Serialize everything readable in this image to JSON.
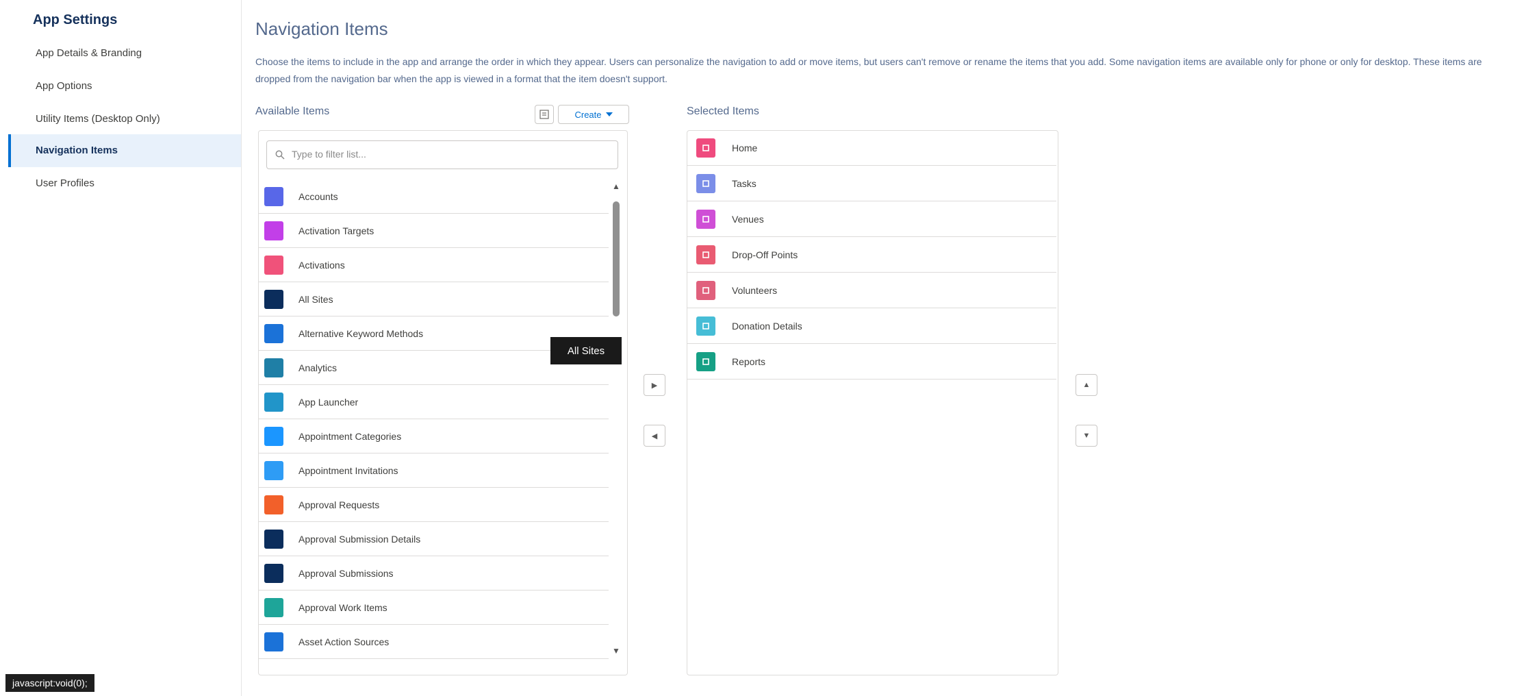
{
  "sidebar": {
    "title": "App Settings",
    "items": [
      {
        "label": "App Details & Branding",
        "active": false
      },
      {
        "label": "App Options",
        "active": false
      },
      {
        "label": "Utility Items (Desktop Only)",
        "active": false
      },
      {
        "label": "Navigation Items",
        "active": true
      },
      {
        "label": "User Profiles",
        "active": false
      }
    ]
  },
  "main": {
    "title": "Navigation Items",
    "description": "Choose the items to include in the app and arrange the order in which they appear. Users can personalize the navigation to add or move items, but users can't remove or rename the items that you add. Some navigation items are available only for phone or only for desktop. These items are dropped from the navigation bar when the app is viewed in a format that the item doesn't support."
  },
  "available": {
    "label": "Available Items",
    "create_label": "Create",
    "search_placeholder": "Type to filter list...",
    "items": [
      {
        "label": "Accounts",
        "color": "#5867e8"
      },
      {
        "label": "Activation Targets",
        "color": "#c23fe8"
      },
      {
        "label": "Activations",
        "color": "#f0527a"
      },
      {
        "label": "All Sites",
        "color": "#0b2d5c"
      },
      {
        "label": "Alternative Keyword Methods",
        "color": "#1b72d8"
      },
      {
        "label": "Analytics",
        "color": "#1f7fa6"
      },
      {
        "label": "App Launcher",
        "color": "#2195c9"
      },
      {
        "label": "Appointment Categories",
        "color": "#1b96ff"
      },
      {
        "label": "Appointment Invitations",
        "color": "#2e9cf5"
      },
      {
        "label": "Approval Requests",
        "color": "#f2602a"
      },
      {
        "label": "Approval Submission Details",
        "color": "#0b2d5c"
      },
      {
        "label": "Approval Submissions",
        "color": "#0b2d5c"
      },
      {
        "label": "Approval Work Items",
        "color": "#1ea599"
      },
      {
        "label": "Asset Action Sources",
        "color": "#1b72d8"
      }
    ]
  },
  "tooltip": "All Sites",
  "selected": {
    "label": "Selected Items",
    "items": [
      {
        "label": "Home",
        "color": "#ef4b7e",
        "icon": "home-icon"
      },
      {
        "label": "Tasks",
        "color": "#7b8ee8",
        "icon": "tasks-icon"
      },
      {
        "label": "Venues",
        "color": "#cf4fd6",
        "icon": "venue-icon"
      },
      {
        "label": "Drop-Off Points",
        "color": "#e95b72",
        "icon": "drop-off-icon"
      },
      {
        "label": "Volunteers",
        "color": "#e0607c",
        "icon": "volunteers-icon"
      },
      {
        "label": "Donation Details",
        "color": "#46bdd6",
        "icon": "document-icon"
      },
      {
        "label": "Reports",
        "color": "#16a085",
        "icon": "report-icon"
      }
    ]
  },
  "status_bar": "javascript:void(0);"
}
